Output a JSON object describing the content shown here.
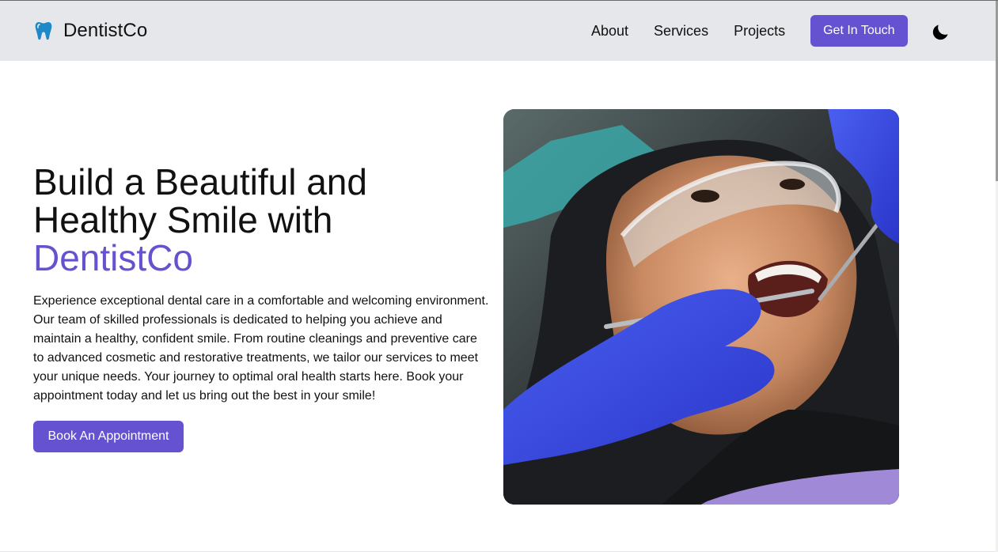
{
  "brand": {
    "name": "DentistCo",
    "icon": "tooth-icon",
    "icon_color": "#1e88c8"
  },
  "nav": {
    "links": [
      "About",
      "Services",
      "Projects"
    ],
    "cta_label": "Get In Touch",
    "theme_icon": "moon-icon"
  },
  "hero": {
    "title_line1": "Build a Beautiful and",
    "title_line2": "Healthy Smile with",
    "title_accent": "DentistCo",
    "description": "Experience exceptional dental care in a comfortable and welcoming environment. Our team of skilled professionals is dedicated to helping you achieve and maintain a healthy, confident smile. From routine cleanings and preventive care to advanced cosmetic and restorative treatments, we tailor our services to meet your unique needs. Your journey to optimal oral health starts here. Book your appointment today and let us bring out the best in your smile!",
    "button_label": "Book An Appointment",
    "image": "dental-patient-photo"
  },
  "colors": {
    "accent": "#6552d0",
    "header_bg": "#e5e7eb",
    "text": "#111111"
  }
}
